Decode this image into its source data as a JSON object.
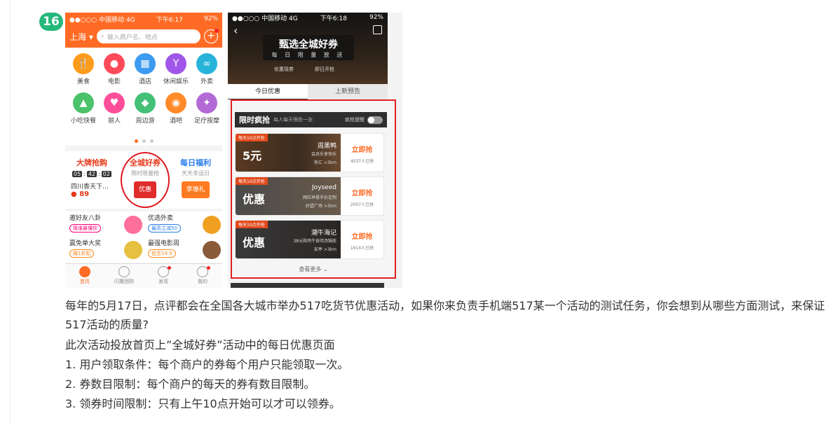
{
  "badge": "16",
  "phone1": {
    "status": {
      "carrier": "●●○○○ 中国移动  4G",
      "time": "下午6:17",
      "battery": "92%"
    },
    "city": "上海",
    "search_placeholder": "输入商户名、地点",
    "categories": [
      {
        "label": "美食",
        "color": "#ff9b1b",
        "glyph": "🍴"
      },
      {
        "label": "电影",
        "color": "#ff4a5a",
        "glyph": "●"
      },
      {
        "label": "酒店",
        "color": "#3c9bf0",
        "glyph": "▦"
      },
      {
        "label": "休闲娱乐",
        "color": "#a056e8",
        "glyph": "Y"
      },
      {
        "label": "外卖",
        "color": "#27b3d9",
        "glyph": "∞"
      },
      {
        "label": "小吃快餐",
        "color": "#4cc26a",
        "glyph": "▲"
      },
      {
        "label": "丽人",
        "color": "#ff4f9a",
        "glyph": "♥"
      },
      {
        "label": "周边游",
        "color": "#44c078",
        "glyph": "◆"
      },
      {
        "label": "酒吧",
        "color": "#ff8a2a",
        "glyph": "◉"
      },
      {
        "label": "足疗按摩",
        "color": "#b36ad6",
        "glyph": "✦"
      }
    ],
    "promos": {
      "left": {
        "title": "大牌抢购",
        "h": "05",
        "m": "42",
        "s": "02",
        "desc": "四川香天下…",
        "price": "89"
      },
      "middle": {
        "title": "全城好券",
        "sub": "限时限量抢",
        "gift": "优惠"
      },
      "right": {
        "title": "每日福利",
        "sub": "天天幸运日",
        "gift": "享壕礼"
      }
    },
    "list": [
      {
        "title": "邀好友八卦",
        "tag": "猜谁最懂你"
      },
      {
        "title": "优选外卖",
        "tag": "最高立减50"
      },
      {
        "title": "赢免单大奖",
        "tag": "赚1折起"
      },
      {
        "title": "最强电影周",
        "tag": "低至19.9"
      }
    ],
    "tabs": [
      "首页",
      "闪惠团购",
      "发现",
      "我的"
    ]
  },
  "phone2": {
    "status": {
      "carrier": "●●○○○ 中国移动  4G",
      "time": "下午6:18",
      "battery": "92%"
    },
    "title": "甄选全城好券",
    "subtitle": "每 日 限 量 放 送",
    "sub_left": "优惠现券",
    "sub_right": "即日开抢",
    "tabs": [
      "今日优惠",
      "上新预告"
    ],
    "flash": {
      "title": "限时疯抢",
      "sub": "每人每天限抢一张",
      "remind": "疯抢提醒"
    },
    "coupons": [
      {
        "ribbon": "每天10点开抢",
        "big": "5元",
        "name": "周黑鸭",
        "desc": "会员乐享快乐",
        "dist": "徐汇 >3km",
        "btn": "立即抢",
        "count": "4037人已抢"
      },
      {
        "ribbon": "每天10点开抢",
        "big": "优惠",
        "name": "Joyseed",
        "desc": "网红早餐半价定制",
        "dist": "好望广场 >3km",
        "btn": "立即抢",
        "count": "2007人已抢"
      },
      {
        "ribbon": "每天10点开抢",
        "big": "优惠",
        "name": "潮牛海记",
        "desc": "38元购鸡牛食肉汤锅底",
        "dist": "安亭 >3km",
        "btn": "立即抢",
        "count": "1914人已抢"
      }
    ],
    "more": "查看更多"
  },
  "question": "每年的5月17日，点评都会在全国各大城市举办517吃货节优惠活动，如果你来负责手机端517某一个活动的测试任务，你会想到从哪些方面测试，来保证517活动的质量?",
  "lines": [
    "此次活动投放首页上”全城好券”活动中的每日优惠页面",
    "1. 用户领取条件：每个商户的券每个用户只能领取一次。",
    "2. 券数目限制：每个商户的每天的券有数目限制。",
    "3. 领券时间限制：只有上午10点开始可以才可以领券。"
  ]
}
